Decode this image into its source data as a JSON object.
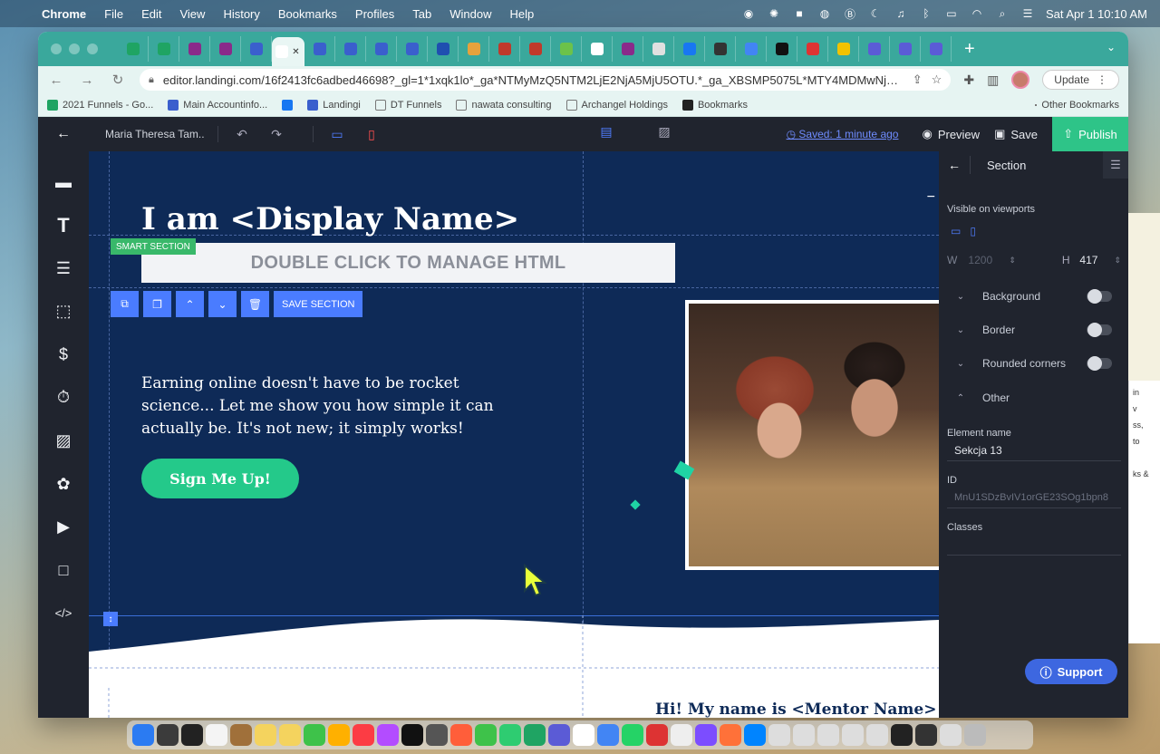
{
  "menubar": {
    "apple": "",
    "app_name": "Chrome",
    "menus": [
      "File",
      "Edit",
      "View",
      "History",
      "Bookmarks",
      "Profiles",
      "Tab",
      "Window",
      "Help"
    ],
    "clock": "Sat Apr 1  10:10 AM"
  },
  "browser": {
    "url": "editor.landingi.com/16f2413fc6adbed46698?_gl=1*1xqk1lo*_ga*NTMyMzQ5NTM2LjE2NjA5MjU5OTU.*_ga_XBSMP5075L*MTY4MDMwNjU0Mi41...",
    "update_label": "Update",
    "new_tab": "+",
    "bookmarks": [
      {
        "label": "2021 Funnels - Go...",
        "color": "#1fa463"
      },
      {
        "label": "Main Accountinfo...",
        "color": "#3a5fcd"
      },
      {
        "label": "",
        "color": "#1877f2"
      },
      {
        "label": "Landingi",
        "color": "#3a5fcd"
      },
      {
        "label": "DT Funnels",
        "color": "#777777"
      },
      {
        "label": "nawata consulting",
        "color": "#777777"
      },
      {
        "label": "Archangel Holdings",
        "color": "#777777"
      },
      {
        "label": "Bookmarks",
        "color": "#222222"
      }
    ],
    "other_bookmarks": "Other Bookmarks",
    "tab_favicon_colors": [
      "#1fa463",
      "#1fa463",
      "#8a2a8a",
      "#8a2a8a",
      "#3a5fcd",
      "#ffffff",
      "#3a5fcd",
      "#3a5fcd",
      "#3a5fcd",
      "#3a5fcd",
      "#1f4fb0",
      "#e6a23c",
      "#c0392b",
      "#c0392b",
      "#6cc24a",
      "#ffffff",
      "#8a2a8a",
      "#e0e0e0",
      "#1877f2",
      "#333333",
      "#4285f4",
      "#111111",
      "#dd3333",
      "#f2c200",
      "#5b5bd6",
      "#5b5bd6",
      "#5b5bd6"
    ]
  },
  "editor": {
    "page_name": "Maria Theresa Tam...",
    "saved_text": "Saved: 1 minute ago",
    "preview_label": "Preview",
    "save_label": "Save",
    "publish_label": "Publish",
    "canvas": {
      "headline": "I am <Display Name>",
      "smart_section_label": "SMART SECTION",
      "html_placeholder": "DOUBLE CLICK TO MANAGE HTML",
      "save_section_label": "SAVE SECTION",
      "paragraph": "Earning online doesn't have to be rocket science... Let me show you how simple it can actually be. It's not new; it simply works!",
      "cta_label": "Sign Me Up!",
      "next_section_text": "Hi! My name is <Mentor Name> and I..."
    },
    "panel": {
      "title": "Section",
      "visible_on_viewports": "Visible on viewports",
      "width_label": "W",
      "width_value": "1200",
      "height_label": "H",
      "height_value": "417",
      "background_label": "Background",
      "border_label": "Border",
      "rounded_corners_label": "Rounded corners",
      "other_label": "Other",
      "element_name_label": "Element name",
      "element_name_value": "Sekcja 13",
      "id_label": "ID",
      "id_value": "MnU1SDzBvIV1orGE23SOg1bpn8",
      "classes_label": "Classes",
      "support_label": "Support"
    }
  },
  "bg_window_text": "in\nv\nss,\nto\n\nks &",
  "colors": {
    "tabstrip": "#3aa89c",
    "editor_chrome": "#20242e",
    "canvas_bg": "#0e2a57",
    "cta": "#24c98a",
    "publish": "#2ec488",
    "accent_blue": "#4a7cff"
  },
  "dock_app_colors": [
    "#2b7bf2",
    "#3b3b3b",
    "#222222",
    "#f4f4f4",
    "#a0703a",
    "#f4d35e",
    "#f4d35e",
    "#3ec24a",
    "#ffb000",
    "#fc3c44",
    "#b34cff",
    "#111111",
    "#555555",
    "#ff5e3a",
    "#3ec24a",
    "#2ecc71",
    "#1fa463",
    "#5b5bd6",
    "#ffffff",
    "#4285f4",
    "#25d366",
    "#dd3333",
    "#eeeeee",
    "#7c4dff",
    "#ff7139",
    "#0084ff",
    "#dddddd",
    "#dddddd",
    "#dddddd",
    "#dddddd",
    "#dddddd",
    "#222222",
    "#333333",
    "#dddddd",
    "#bbbbbb"
  ]
}
